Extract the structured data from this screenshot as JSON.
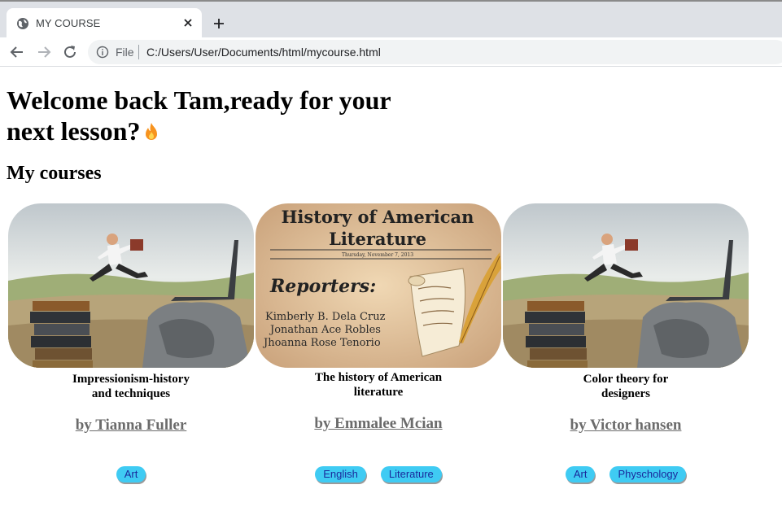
{
  "browser": {
    "tab_title": "MY COURSE",
    "address_scheme": "File",
    "address_url": "C:/Users/User/Documents/html/mycourse.html"
  },
  "page": {
    "headline_line1": "Welcome back Tam,ready for your",
    "headline_line2": "next lesson?",
    "section_title": "My courses"
  },
  "courses": [
    {
      "title_line1": "Impressionism-history",
      "title_line2": "and techniques",
      "author": "by Tianna Fuller",
      "tags": [
        "Art"
      ],
      "image_icon": "leaping-businessman-image"
    },
    {
      "title_line1": "The history of American",
      "title_line2": "literature",
      "author": "by Emmalee Mcian",
      "tags": [
        "English",
        "Literature"
      ],
      "image": {
        "headline_line1": "History of American",
        "headline_line2": "Literature",
        "dateline": "Thursday, November 7, 2013",
        "reporters_label": "Reporters:",
        "names": [
          "Kimberly B. Dela Cruz",
          "Jonathan Ace Robles",
          "Jhoanna Rose Tenorio"
        ]
      }
    },
    {
      "title_line1": "Color theory for",
      "title_line2": "designers",
      "author": "by Victor hansen",
      "tags": [
        "Art",
        "Physchology"
      ],
      "image_icon": "leaping-businessman-image"
    }
  ],
  "colors": {
    "tag_bg": "#3fcbf3",
    "tag_text": "#1a2a9c",
    "author_link": "#6b6b6b"
  }
}
